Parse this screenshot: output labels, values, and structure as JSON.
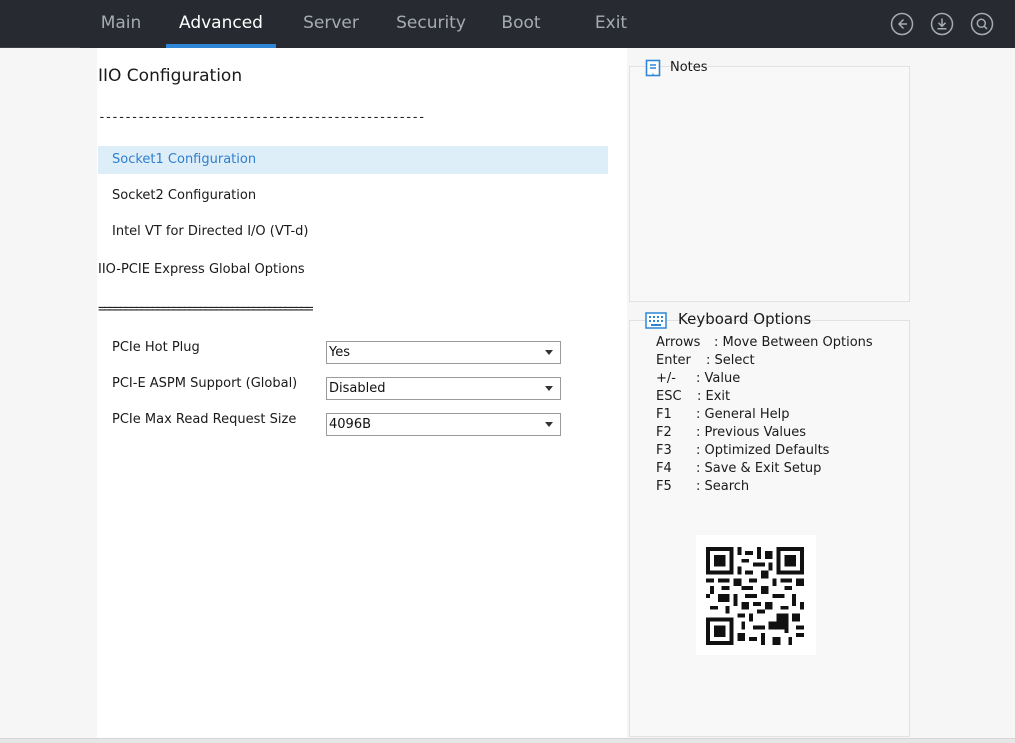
{
  "tabs": [
    {
      "label": "Main",
      "active": false
    },
    {
      "label": "Advanced",
      "active": true
    },
    {
      "label": "Server",
      "active": false
    },
    {
      "label": "Security",
      "active": false
    },
    {
      "label": "Boot",
      "active": false
    },
    {
      "label": "Exit",
      "active": false
    }
  ],
  "toolbar_icons": [
    "back-icon",
    "download-icon",
    "search-icon"
  ],
  "page": {
    "title": "IIO Configuration",
    "separator_top": "--------------------------------------------------",
    "menu_items": [
      {
        "label": "Socket1 Configuration",
        "selected": true
      },
      {
        "label": "Socket2 Configuration",
        "selected": false
      },
      {
        "label": "Intel VT for Directed I/O (VT-d)",
        "selected": false
      }
    ],
    "group_label": "IIO-PCIE Express Global Options",
    "separator_bottom": "========================================",
    "options": [
      {
        "label": "PCIe Hot Plug",
        "value": "Yes"
      },
      {
        "label": "PCI-E ASPM Support (Global)",
        "value": "Disabled"
      },
      {
        "label": "PCIe Max Read Request Size",
        "value": "4096B"
      }
    ]
  },
  "notes": {
    "title": "Notes",
    "icon": "bookmark-icon"
  },
  "keyboard": {
    "title": "Keyboard Options",
    "icon": "keyboard-icon",
    "lines": [
      {
        "key": "Arrows",
        "desc": ": Move Between Options"
      },
      {
        "key": "Enter",
        "desc": ": Select"
      },
      {
        "key": "+/-",
        "desc": ": Value"
      },
      {
        "key": "ESC",
        "desc": ": Exit"
      },
      {
        "key": "F1",
        "desc": ": General Help"
      },
      {
        "key": "F2",
        "desc": ": Previous Values"
      },
      {
        "key": "F3",
        "desc": ": Optimized Defaults"
      },
      {
        "key": "F4",
        "desc": ": Save & Exit Setup"
      },
      {
        "key": "F5",
        "desc": ": Search"
      }
    ]
  },
  "colors": {
    "accent": "#2f86d6",
    "topbar": "#272a30",
    "selected_bg": "#deeef9"
  }
}
